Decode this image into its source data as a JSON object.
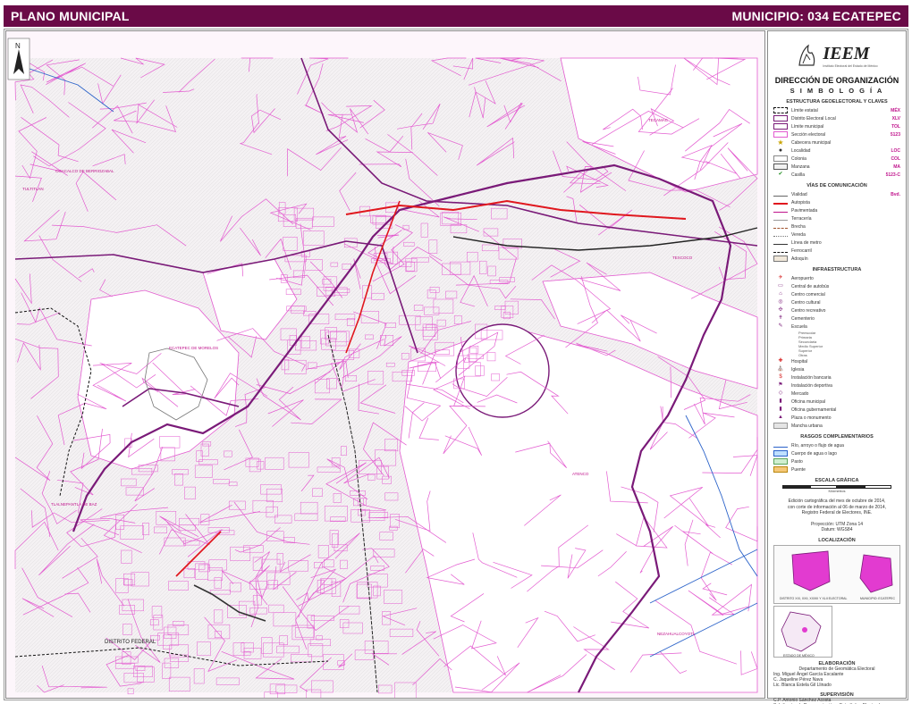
{
  "header": {
    "left_title": "PLANO MUNICIPAL",
    "right_title": "MUNICIPIO: 034 ECATEPEC"
  },
  "map": {
    "labels": [
      {
        "text": "TECAMAC"
      },
      {
        "text": "COACALCO DE BERRIOZABAL"
      },
      {
        "text": "TULTITLAN"
      },
      {
        "text": "TEXCOCO"
      },
      {
        "text": "ECATEPEC DE MORELOS"
      },
      {
        "text": "ATENCO"
      },
      {
        "text": "TLALNEPANTLA DE BAZ"
      },
      {
        "text": "DISTRITO FEDERAL"
      },
      {
        "text": "NEZAHUALCOYOTL"
      }
    ],
    "north_label": "N",
    "colors": {
      "section_line": "#e35bd0",
      "district_line": "#7a1a78",
      "highway": "#e0171e",
      "railway": "#222222",
      "urban": "#cfcfcf"
    }
  },
  "panel": {
    "logo_text": "IEEM",
    "logo_subtitle": "Instituto Electoral del Estado de México",
    "org": "DIRECCIÓN DE ORGANIZACIÓN",
    "simbologia": "S I M B O L O G Í A",
    "sec_estructura": "ESTRUCTURA GEOELECTORAL Y CLAVES",
    "estructura": [
      {
        "label": "Límite estatal",
        "code": "MÉX",
        "icon": "state-limit"
      },
      {
        "label": "Distrito Electoral Local",
        "code": "XLV",
        "icon": "district-limit"
      },
      {
        "label": "Límite municipal",
        "code": "TOL",
        "icon": "municipal-limit"
      },
      {
        "label": "Sección electoral",
        "code": "5123",
        "icon": "section-limit"
      },
      {
        "label": "Cabecera municipal",
        "code": "",
        "icon": "star-icon"
      },
      {
        "label": "Localidad",
        "code": "LOC",
        "icon": "dot-icon"
      },
      {
        "label": "Colonia",
        "code": "COL",
        "icon": "colonia-icon"
      },
      {
        "label": "Manzana",
        "code": "MA",
        "icon": "manzana-icon"
      },
      {
        "label": "Casilla",
        "code": "5123-C",
        "icon": "check-icon"
      }
    ],
    "sec_vias": "VÍAS DE COMUNICACIÓN",
    "vias": [
      {
        "label": "Vialidad",
        "code": "Bvd.",
        "icon": "road-line"
      },
      {
        "label": "Autopista",
        "code": "",
        "icon": "highway-line"
      },
      {
        "label": "Pavimentada",
        "code": "",
        "icon": "paved-line"
      },
      {
        "label": "Terracería",
        "code": "",
        "icon": "dirt-line"
      },
      {
        "label": "Brecha",
        "code": "",
        "icon": "trail-line"
      },
      {
        "label": "Vereda",
        "code": "",
        "icon": "path-line"
      },
      {
        "label": "Línea de metro",
        "code": "",
        "icon": "metro-line"
      },
      {
        "label": "Ferrocarril",
        "code": "",
        "icon": "rail-line"
      },
      {
        "label": "Adoquín",
        "code": "",
        "icon": "cobble-box"
      }
    ],
    "sec_infra": "INFRAESTRUCTURA",
    "infra": [
      {
        "label": "Aeropuerto",
        "icon": "airport-icon"
      },
      {
        "label": "Central de autobús",
        "icon": "bus-icon"
      },
      {
        "label": "Centro comercial",
        "icon": "shop-icon"
      },
      {
        "label": "Centro cultural",
        "icon": "culture-icon"
      },
      {
        "label": "Centro recreativo",
        "icon": "recreation-icon"
      },
      {
        "label": "Cementerio",
        "icon": "cemetery-icon"
      },
      {
        "label": "Escuela",
        "icon": "school-icon"
      }
    ],
    "escuela_sub": [
      "Preescolar",
      "Primaria",
      "Secundaria",
      "Medio Superior",
      "Superior",
      "Otras"
    ],
    "infra2": [
      {
        "label": "Hospital",
        "icon": "hospital-icon"
      },
      {
        "label": "Iglesia",
        "icon": "church-icon"
      },
      {
        "label": "Instalación bancaria",
        "icon": "bank-icon"
      },
      {
        "label": "Instalación deportiva",
        "icon": "sport-icon"
      },
      {
        "label": "Mercado",
        "icon": "market-icon"
      },
      {
        "label": "Oficina municipal",
        "icon": "office-icon"
      },
      {
        "label": "Oficina gubernamental",
        "icon": "gov-icon"
      },
      {
        "label": "Plaza o monumento",
        "icon": "monument-icon"
      },
      {
        "label": "Mancha urbana",
        "icon": "urban-box"
      }
    ],
    "sec_rasgos": "RASGOS COMPLEMENTARIOS",
    "rasgos": [
      {
        "label": "Río, arroyo o flujo de agua",
        "icon": "river-line"
      },
      {
        "label": "Cuerpo de agua o lago",
        "icon": "lake-box"
      },
      {
        "label": "Pasto",
        "icon": "grass-box"
      },
      {
        "label": "Puente",
        "icon": "bridge-box"
      }
    ],
    "sec_escala": "ESCALA GRÁFICA",
    "scale_unit": "Kilómetros",
    "note_lines": [
      "Edición cartográfica del mes de octubre de 2014,",
      "con corte de información al 06 de marzo de 2014,",
      "Registro Federal de Electores, INE."
    ],
    "projection_lines": [
      "Proyección: UTM Zona 14",
      "Datum: WGS84"
    ],
    "sec_localizacion": "LOCALIZACIÓN",
    "loc_caption_left": "DISTRITO XXI, XXII, XXXIII Y XLII ELECTORAL",
    "loc_caption_right": "MUNICIPIO: ECATEPEC",
    "loc_state_caption": "ESTADO DE MÉXICO",
    "sec_elaboracion": "ELABORACIÓN",
    "elaboracion_dept": "Departamento de Geomática Electoral",
    "elaboracion_people": [
      "Ing. Miguel Ángel García Escalante",
      "C. Jaqueline Pérez Nava",
      "Lic. Blanca Estela Gil Llinado"
    ],
    "sec_supervision": "SUPERVISIÓN",
    "supervision_people": [
      "C.P. Antonio Sánchez Acosta",
      "Subdirector de Documentación y Estadística Electoral"
    ]
  }
}
